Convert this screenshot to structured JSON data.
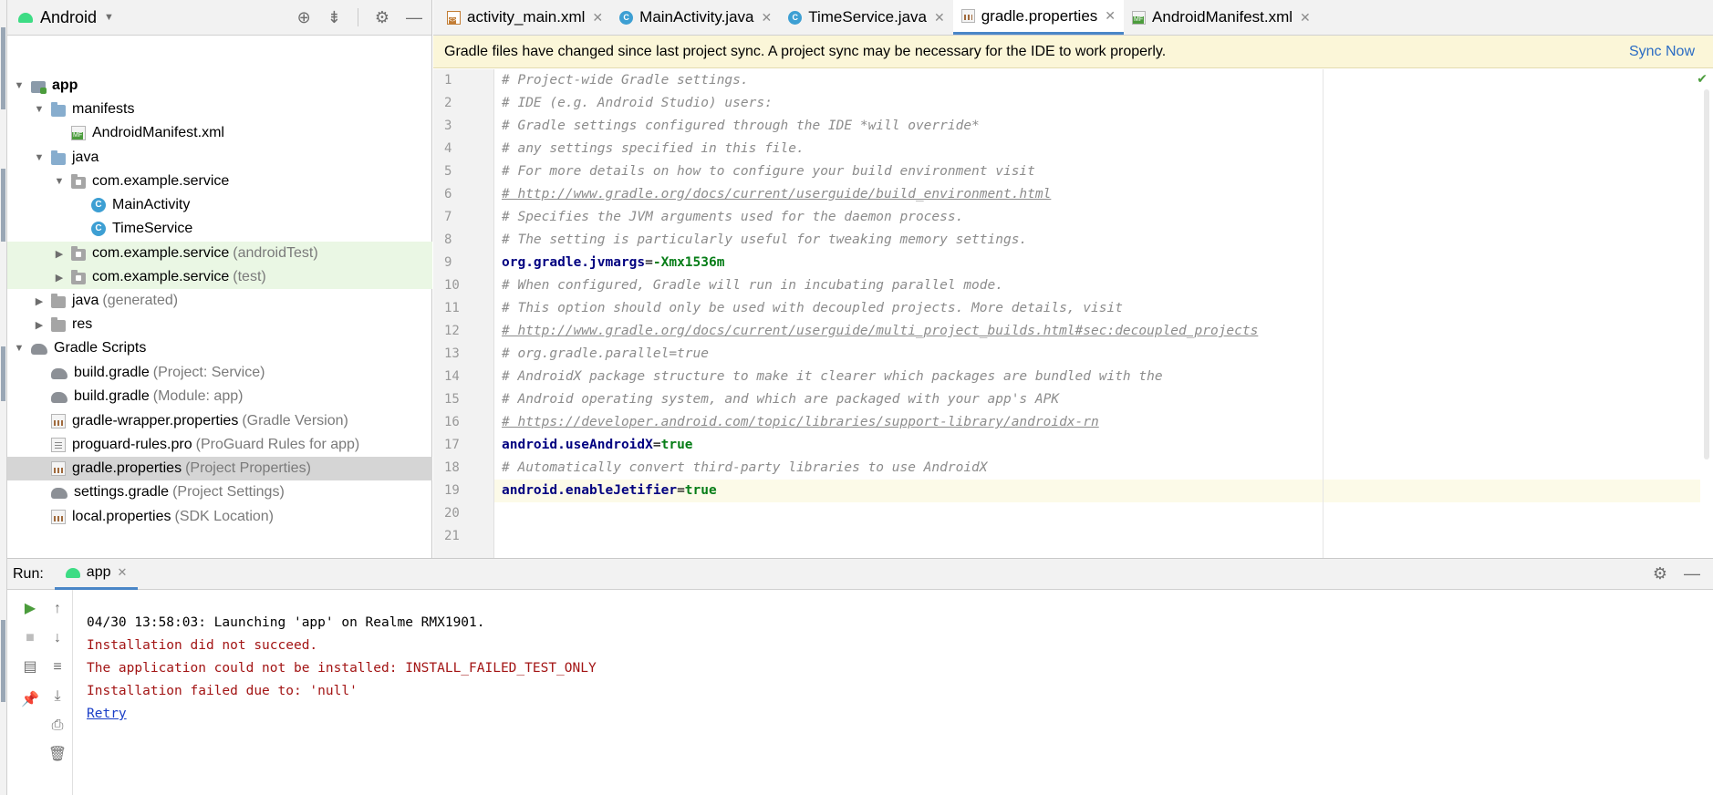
{
  "project_panel": {
    "view_label": "Android",
    "tree": [
      {
        "label": "app",
        "hint": "",
        "icon": "module-folder-icon",
        "arrow": "expanded",
        "depth": 0
      },
      {
        "label": "manifests",
        "hint": "",
        "icon": "folder-icon",
        "arrow": "expanded",
        "depth": 1
      },
      {
        "label": "AndroidManifest.xml",
        "hint": "",
        "icon": "manifest-file-icon",
        "arrow": "none",
        "depth": 2
      },
      {
        "label": "java",
        "hint": "",
        "icon": "folder-icon",
        "arrow": "expanded",
        "depth": 1
      },
      {
        "label": "com.example.service",
        "hint": "",
        "icon": "package-icon",
        "arrow": "expanded",
        "depth": 2
      },
      {
        "label": "MainActivity",
        "hint": "",
        "icon": "class-icon",
        "arrow": "none",
        "depth": 3
      },
      {
        "label": "TimeService",
        "hint": "",
        "icon": "class-icon",
        "arrow": "none",
        "depth": 3
      },
      {
        "label": "com.example.service",
        "hint": "(androidTest)",
        "icon": "package-icon",
        "arrow": "collapsed",
        "depth": 2
      },
      {
        "label": "com.example.service",
        "hint": "(test)",
        "icon": "package-icon",
        "arrow": "collapsed",
        "depth": 2
      },
      {
        "label": "java",
        "hint": "(generated)",
        "icon": "generated-folder-icon",
        "arrow": "collapsed",
        "depth": 1
      },
      {
        "label": "res",
        "hint": "",
        "icon": "resource-folder-icon",
        "arrow": "collapsed",
        "depth": 1
      },
      {
        "label": "Gradle Scripts",
        "hint": "",
        "icon": "gradle-icon",
        "arrow": "expanded",
        "depth": 0
      },
      {
        "label": "build.gradle",
        "hint": "(Project: Service)",
        "icon": "gradle-icon",
        "arrow": "none",
        "depth": 1
      },
      {
        "label": "build.gradle",
        "hint": "(Module: app)",
        "icon": "gradle-icon",
        "arrow": "none",
        "depth": 1
      },
      {
        "label": "gradle-wrapper.properties",
        "hint": "(Gradle Version)",
        "icon": "properties-file-icon",
        "arrow": "none",
        "depth": 1
      },
      {
        "label": "proguard-rules.pro",
        "hint": "(ProGuard Rules for app)",
        "icon": "text-file-icon",
        "arrow": "none",
        "depth": 1
      },
      {
        "label": "gradle.properties",
        "hint": "(Project Properties)",
        "icon": "properties-file-icon",
        "arrow": "none",
        "depth": 1
      },
      {
        "label": "settings.gradle",
        "hint": "(Project Settings)",
        "icon": "gradle-icon",
        "arrow": "none",
        "depth": 1
      },
      {
        "label": "local.properties",
        "hint": "(SDK Location)",
        "icon": "properties-file-icon",
        "arrow": "none",
        "depth": 1
      }
    ]
  },
  "editor": {
    "tabs": [
      {
        "label": "activity_main.xml",
        "icon": "layout-xml-icon",
        "active": false
      },
      {
        "label": "MainActivity.java",
        "icon": "class-icon",
        "active": false
      },
      {
        "label": "TimeService.java",
        "icon": "class-icon",
        "active": false
      },
      {
        "label": "gradle.properties",
        "icon": "properties-file-icon",
        "active": true
      },
      {
        "label": "AndroidManifest.xml",
        "icon": "manifest-file-icon",
        "active": false
      }
    ],
    "notification": {
      "message": "Gradle files have changed since last project sync. A project sync may be necessary for the IDE to work properly.",
      "action": "Sync Now"
    },
    "lines": [
      {
        "num": "1",
        "type": "comment",
        "text": "# Project-wide Gradle settings."
      },
      {
        "num": "2",
        "type": "comment",
        "text": "# IDE (e.g. Android Studio) users:"
      },
      {
        "num": "3",
        "type": "comment",
        "text": "# Gradle settings configured through the IDE *will override*"
      },
      {
        "num": "4",
        "type": "comment",
        "text": "# any settings specified in this file."
      },
      {
        "num": "5",
        "type": "comment",
        "text": "# For more details on how to configure your build environment visit"
      },
      {
        "num": "6",
        "type": "link",
        "text": "# http://www.gradle.org/docs/current/userguide/build_environment.html"
      },
      {
        "num": "7",
        "type": "comment",
        "text": "# Specifies the JVM arguments used for the daemon process."
      },
      {
        "num": "8",
        "type": "comment",
        "text": "# The setting is particularly useful for tweaking memory settings."
      },
      {
        "num": "9",
        "type": "kv",
        "key": "org.gradle.jvmargs",
        "value": "-Xmx1536m"
      },
      {
        "num": "10",
        "type": "comment",
        "text": "# When configured, Gradle will run in incubating parallel mode."
      },
      {
        "num": "11",
        "type": "comment",
        "text": "# This option should only be used with decoupled projects. More details, visit"
      },
      {
        "num": "12",
        "type": "link",
        "text": "# http://www.gradle.org/docs/current/userguide/multi_project_builds.html#sec:decoupled_projects"
      },
      {
        "num": "13",
        "type": "comment",
        "text": "# org.gradle.parallel=true"
      },
      {
        "num": "14",
        "type": "comment",
        "text": "# AndroidX package structure to make it clearer which packages are bundled with the"
      },
      {
        "num": "15",
        "type": "comment",
        "text": "# Android operating system, and which are packaged with your app's APK"
      },
      {
        "num": "16",
        "type": "link",
        "text": "# https://developer.android.com/topic/libraries/support-library/androidx-rn"
      },
      {
        "num": "17",
        "type": "kv",
        "key": "android.useAndroidX",
        "value": "true"
      },
      {
        "num": "18",
        "type": "comment",
        "text": "# Automatically convert third-party libraries to use AndroidX"
      },
      {
        "num": "19",
        "type": "kv",
        "key": "android.enableJetifier",
        "value": "true",
        "current": true
      },
      {
        "num": "20",
        "type": "empty",
        "text": ""
      },
      {
        "num": "21",
        "type": "empty",
        "text": ""
      }
    ]
  },
  "run_panel": {
    "title": "Run:",
    "tab_label": "app",
    "console": [
      {
        "type": "info",
        "text": "04/30 13:58:03: Launching 'app' on Realme RMX1901."
      },
      {
        "type": "err",
        "text": "Installation did not succeed."
      },
      {
        "type": "err",
        "text": "The application could not be installed: INSTALL_FAILED_TEST_ONLY"
      },
      {
        "type": "err",
        "text": "Installation failed due to: 'null'"
      },
      {
        "type": "link",
        "text": "Retry"
      }
    ]
  },
  "colors": {
    "accent": "#4a86c7",
    "comment": "#8c8c8c",
    "key": "#000080",
    "value": "#067d17",
    "error": "#a31515",
    "link": "#1a3ec7",
    "notification_bg": "#fbf6d8",
    "selection_bg": "#d5d5d5",
    "test_folder_bg": "#eaf7e4"
  }
}
